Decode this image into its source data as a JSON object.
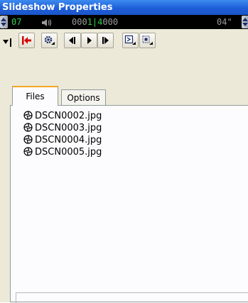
{
  "window": {
    "title": "Slideshow Properties"
  },
  "counter": {
    "slide_number": "07",
    "time_prefix": "000",
    "time_current": "1",
    "time_mid": "|4",
    "time_suffix": "000",
    "duration": "04\""
  },
  "colors": {
    "counter_green": "#2fd14a",
    "counter_dim_green": "#1c7a2c",
    "counter_gray": "#9a9a9a",
    "titlebar": "#1e5ed8",
    "tab_highlight": "#f5a623"
  },
  "toolbar": {
    "buttons": [
      {
        "icon": "dropdown-arrow-icon"
      },
      {
        "icon": "go-to-start-icon"
      },
      {
        "icon": "settings-gear-icon"
      },
      {
        "icon": "step-back-icon"
      },
      {
        "icon": "play-icon"
      },
      {
        "icon": "step-forward-icon"
      },
      {
        "icon": "sum-dropdown-icon"
      },
      {
        "icon": "fit-dropdown-icon"
      }
    ]
  },
  "tabs": [
    {
      "label": "Files",
      "active": true
    },
    {
      "label": "Options",
      "active": false
    }
  ],
  "files": [
    {
      "name": "DSCN0002.jpg",
      "icon": "camera-shutter-icon"
    },
    {
      "name": "DSCN0003.jpg",
      "icon": "camera-shutter-icon"
    },
    {
      "name": "DSCN0004.jpg",
      "icon": "camera-shutter-icon"
    },
    {
      "name": "DSCN0005.jpg",
      "icon": "camera-shutter-icon"
    }
  ]
}
